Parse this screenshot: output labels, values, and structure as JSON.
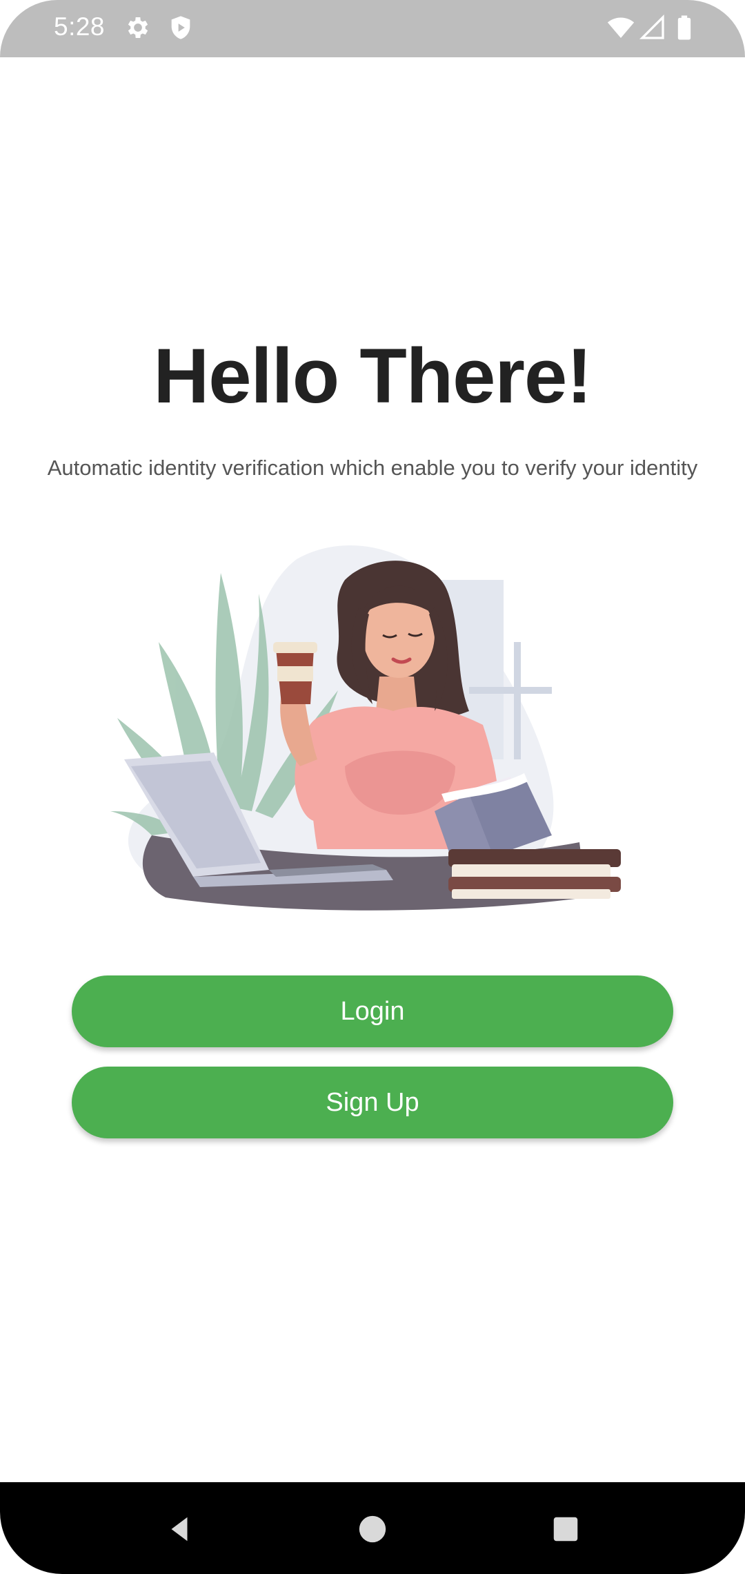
{
  "status_bar": {
    "time": "5:28",
    "left_icons": [
      "settings-icon",
      "shield-play-icon"
    ],
    "right_icons": [
      "wifi-icon",
      "cell-signal-icon",
      "battery-icon"
    ]
  },
  "welcome": {
    "title": "Hello There!",
    "subtitle": "Automatic identity verification which enable you to verify your identity"
  },
  "illustration": {
    "description_icon": "woman-reading-illustration"
  },
  "actions": {
    "login_label": "Login",
    "signup_label": "Sign Up"
  },
  "navigation": {
    "icons": [
      "back-icon",
      "home-icon",
      "recents-icon"
    ]
  },
  "colors": {
    "accent": "#4caf50",
    "title": "#222222",
    "subtitle": "#555555",
    "status_bar": "#bdbdbd"
  }
}
